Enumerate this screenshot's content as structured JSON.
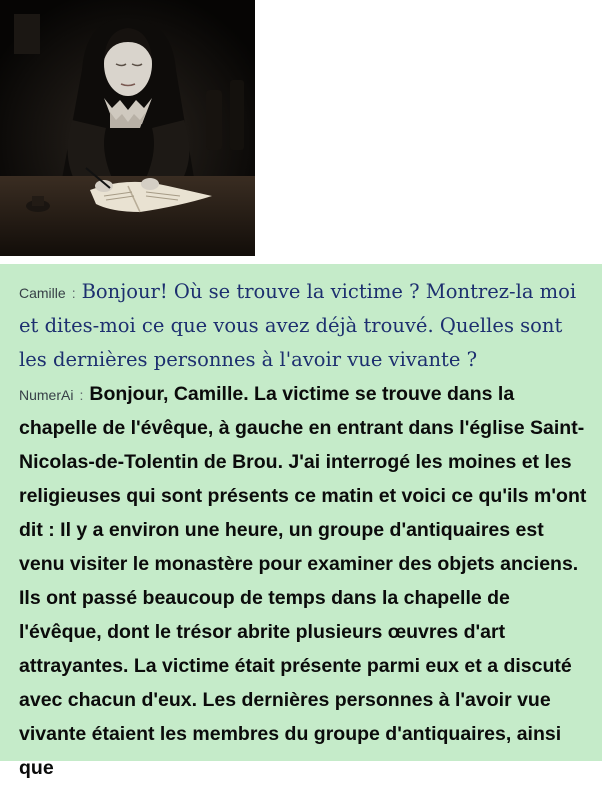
{
  "chat": {
    "messages": [
      {
        "speaker": "Camille",
        "separator": ":",
        "text": "Bonjour! Où se trouve la victime ? Montrez-la moi et dites-moi ce que vous avez déjà trouvé. Quelles sont les dernières personnes à l'avoir vue vivante ?"
      },
      {
        "speaker": "NumerAi",
        "separator": ":",
        "text": "Bonjour, Camille. La victime se trouve dans la chapelle de l'évêque, à gauche en entrant dans l'église Saint-Nicolas-de-Tolentin de Brou. J'ai interrogé les moines et les religieuses qui sont présents ce matin et voici ce qu'ils m'ont dit : Il y a environ une heure, un groupe d'antiquaires est venu visiter le monastère pour examiner des objets anciens. Ils ont passé beaucoup de temps dans la chapelle de l'évêque, dont le trésor abrite plusieurs œuvres d'art attrayantes. La victime était présente parmi eux et a discuté avec chacun d'eux. Les dernières personnes à l'avoir vue vivante étaient les membres du groupe d'antiquaires, ainsi que"
      }
    ]
  },
  "colors": {
    "chat_background": "#c5ebc9",
    "user_text": "#1d2f6f",
    "bot_text": "#0b0b0b",
    "speaker_label": "#374047"
  }
}
